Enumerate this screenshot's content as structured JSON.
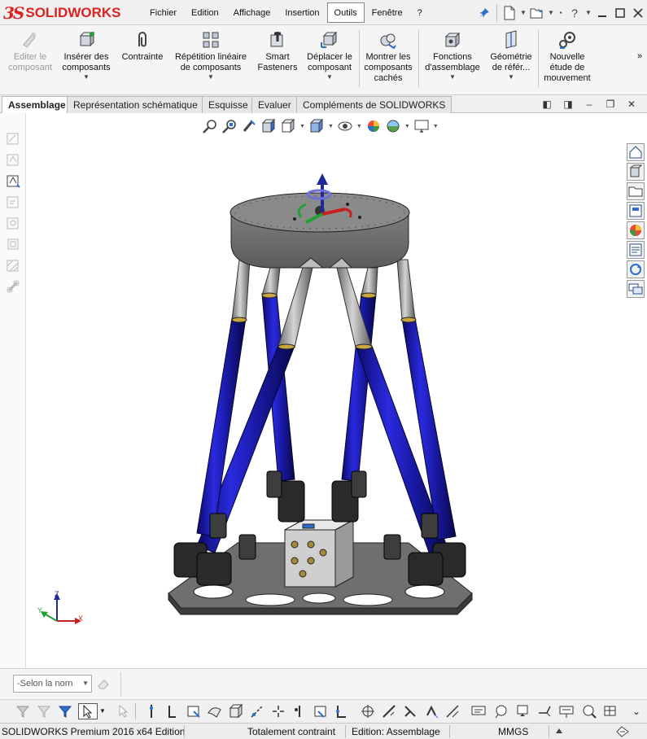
{
  "app": {
    "brand_ds": "3S",
    "brand_solid": "SOLID",
    "brand_works": "WORKS"
  },
  "menubar": {
    "items": [
      "Fichier",
      "Edition",
      "Affichage",
      "Insertion",
      "Outils",
      "Fenêtre",
      "?"
    ],
    "active": "Outils"
  },
  "title_tools": {
    "help": "?"
  },
  "ribbon": {
    "buttons": [
      {
        "label": "Editer le\ncomposant",
        "icon": "edit-component-icon",
        "enabled": false
      },
      {
        "label": "Insérer des\ncomposants",
        "icon": "insert-components-icon",
        "enabled": true,
        "dropdown": true
      },
      {
        "label": "Contrainte",
        "icon": "mate-paperclip-icon",
        "enabled": true
      },
      {
        "label": "Répétition linéaire\nde composants",
        "icon": "linear-pattern-icon",
        "enabled": true,
        "dropdown": true
      },
      {
        "label": "Smart\nFasteners",
        "icon": "smart-fasteners-icon",
        "enabled": true
      },
      {
        "label": "Déplacer le\ncomposant",
        "icon": "move-component-icon",
        "enabled": true,
        "dropdown": true
      },
      {
        "label": "Montrer les\ncomposants\ncachés",
        "icon": "show-hidden-icon",
        "enabled": true
      },
      {
        "label": "Fonctions\nd'assemblage",
        "icon": "assembly-features-icon",
        "enabled": true,
        "dropdown": true
      },
      {
        "label": "Géométrie\nde référ...",
        "icon": "reference-geometry-icon",
        "enabled": true,
        "dropdown": true
      },
      {
        "label": "Nouvelle\nétude de\nmouvement",
        "icon": "motion-study-icon",
        "enabled": true
      }
    ],
    "more": "»"
  },
  "tabs": {
    "items": [
      "Assemblage",
      "Représentation schématique",
      "Esquisse",
      "Evaluer",
      "Compléments de SOLIDWORKS"
    ],
    "active": "Assemblage"
  },
  "triad": {
    "x": "X",
    "y": "Y",
    "z": "Z"
  },
  "filter": {
    "value": "-Selon la norn"
  },
  "status": {
    "product": "SOLIDWORKS Premium 2016 x64 Edition",
    "constraint": "Totalement contraint",
    "mode": "Edition: Assemblage",
    "units": "MMGS"
  },
  "colors": {
    "accent_red": "#d22222",
    "strut_blue": "#1a1aa8",
    "plate_gray": "#8c8c8c"
  }
}
